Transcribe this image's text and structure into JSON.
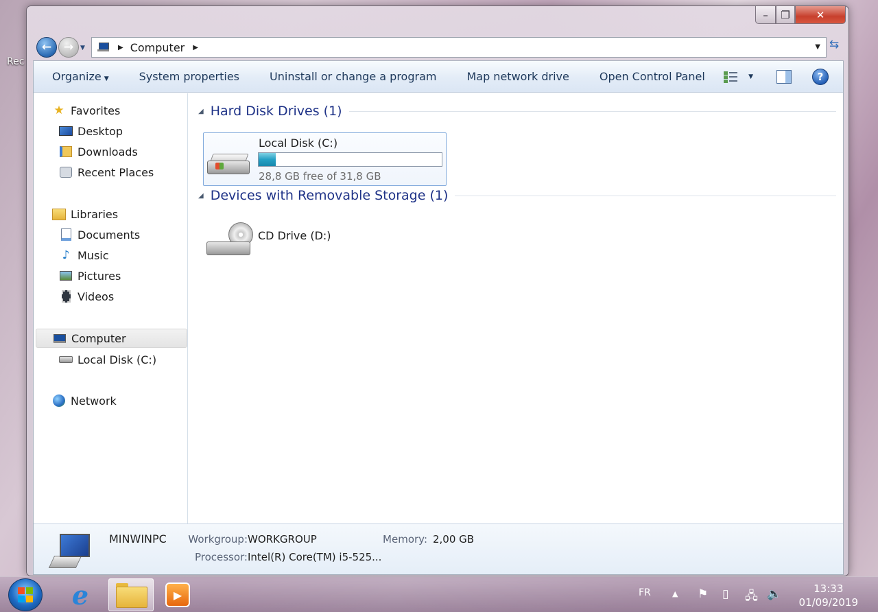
{
  "desktop": {
    "partial_label": "Rec"
  },
  "window": {
    "caption_buttons": {
      "minimize": "–",
      "maximize": "❐",
      "close": "✕"
    },
    "nav": {
      "back": "←",
      "forward": "→"
    },
    "address": {
      "crumb": "Computer"
    },
    "command_bar": {
      "organize": "Organize",
      "system_properties": "System properties",
      "uninstall": "Uninstall or change a program",
      "map_drive": "Map network drive",
      "control_panel": "Open Control Panel",
      "help": "?"
    },
    "navigation": {
      "favorites": "Favorites",
      "desktop": "Desktop",
      "downloads": "Downloads",
      "recent": "Recent Places",
      "libraries": "Libraries",
      "documents": "Documents",
      "music": "Music",
      "pictures": "Pictures",
      "videos": "Videos",
      "computer": "Computer",
      "local_disk": "Local Disk (C:)",
      "network": "Network"
    },
    "groups": {
      "hard_disks": "Hard Disk Drives (1)",
      "removable": "Devices with Removable Storage (1)"
    },
    "drives": {
      "c": {
        "name": "Local Disk (C:)",
        "info": "28,8 GB free of 31,8 GB",
        "used_fraction": 0.094
      },
      "d": {
        "name": "CD Drive (D:)"
      }
    },
    "details": {
      "pc_name": "MINWINPC",
      "workgroup_label": "Workgroup:",
      "workgroup_value": "WORKGROUP",
      "memory_label": "Memory:",
      "memory_value": "2,00 GB",
      "processor_label": "Processor:",
      "processor_value": "Intel(R) Core(TM) i5-525..."
    }
  },
  "taskbar": {
    "language": "FR",
    "time": "13:33",
    "date": "01/09/2019"
  },
  "colors": {
    "accent": "#1e3287",
    "usage_fill": "#25a0c4",
    "close_button": "#c7402d"
  }
}
